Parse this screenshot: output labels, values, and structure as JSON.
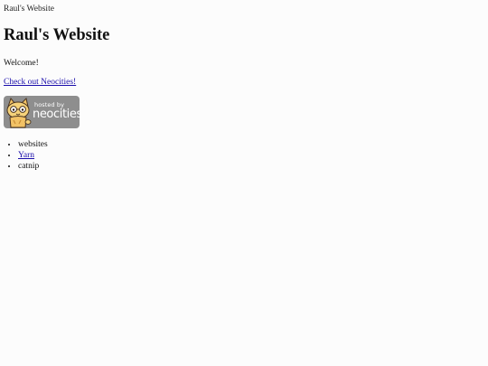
{
  "window": {
    "title": "Raul's Website"
  },
  "page": {
    "heading": "Raul's Website",
    "welcome": "Welcome!",
    "neocities_link": "Check out Neocities!",
    "badge": {
      "hosted_text": "hosted by",
      "brand_text": "neocities",
      "mascot": "neocities-cat-icon",
      "background": "#8e8e8e"
    },
    "list": [
      {
        "text": "websites",
        "is_link": false
      },
      {
        "text": "Yarn",
        "is_link": true
      },
      {
        "text": "catnip",
        "is_link": false
      }
    ]
  },
  "colors": {
    "link": "#1a0dab",
    "text": "#111111",
    "background": "#fcfcfc"
  }
}
